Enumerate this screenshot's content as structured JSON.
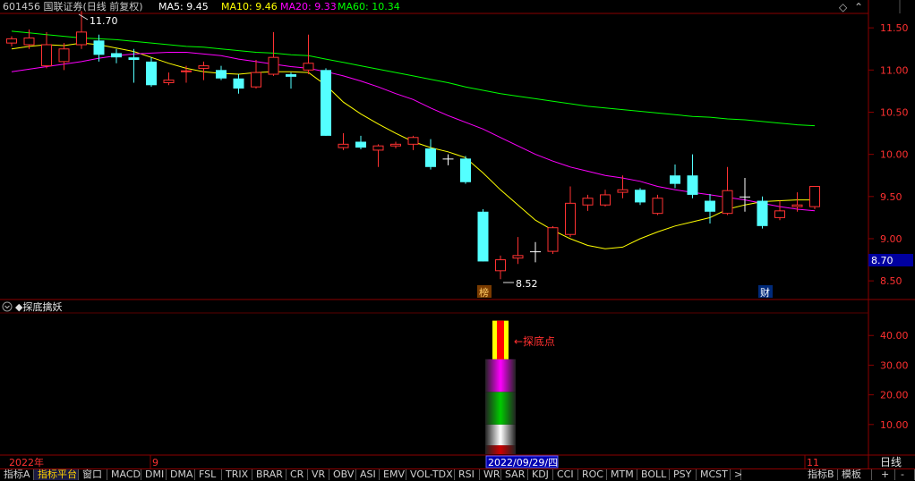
{
  "header": {
    "stock_label": "601456 国联证券(日线 前复权)",
    "ma5_label": "MA5: 9.45",
    "ma10_label": "MA10: 9.46",
    "ma20_label": "MA20: 9.33",
    "ma60_label": "MA60: 10.34",
    "colors": {
      "ma5": "#ffffff",
      "ma10": "#ffff00",
      "ma20": "#ff00ff",
      "ma60": "#00ff00"
    }
  },
  "indicator": {
    "title": "◆探底擒妖",
    "marker_label": "←探底点",
    "y_ticks": [
      "40.00",
      "30.00",
      "20.00",
      "10.00"
    ]
  },
  "price_axis": {
    "ticks": [
      "11.50",
      "11.00",
      "10.50",
      "10.00",
      "9.50",
      "9.00",
      "8.50"
    ],
    "current_price_badge": "8.70"
  },
  "annotations": {
    "high_label": "11.70",
    "low_label": "8.52",
    "badge_bang": "榜",
    "badge_cai": "财"
  },
  "time_axis": {
    "year_label": "2022年",
    "month_9_label": "9",
    "date_cursor_label": "2022/09/29/四",
    "month_11_label": "11",
    "period_label": "日线"
  },
  "tabs": [
    "指标A",
    "指标平台",
    "窗口",
    "MACD",
    "DMI",
    "DMA",
    "FSL",
    "TRIX",
    "BRAR",
    "CR",
    "VR",
    "OBV",
    "ASI",
    "EMV",
    "VOL-TDX",
    "RSI",
    "WR",
    "SAR",
    "KDJ",
    "CCI",
    "ROC",
    "MTM",
    "BOLL",
    "PSY",
    "MCST",
    ">"
  ],
  "right_tabs": [
    "指标B",
    "模板",
    "+",
    "-"
  ],
  "chart_data": [
    {
      "type": "candlestick",
      "title": "601456 国联证券(日线 前复权)",
      "ylim": [
        8.3,
        11.65
      ],
      "y_ticks": [
        11.5,
        11.0,
        10.5,
        10.0,
        9.5,
        9.0,
        8.5
      ],
      "candles": [
        {
          "o": 11.32,
          "h": 11.4,
          "l": 11.28,
          "c": 11.37
        },
        {
          "o": 11.3,
          "h": 11.48,
          "l": 11.25,
          "c": 11.38
        },
        {
          "o": 11.05,
          "h": 11.45,
          "l": 11.02,
          "c": 11.3
        },
        {
          "o": 11.1,
          "h": 11.32,
          "l": 11.0,
          "c": 11.25
        },
        {
          "o": 11.3,
          "h": 11.7,
          "l": 11.25,
          "c": 11.45
        },
        {
          "o": 11.35,
          "h": 11.42,
          "l": 11.1,
          "c": 11.18
        },
        {
          "o": 11.2,
          "h": 11.25,
          "l": 11.08,
          "c": 11.15
        },
        {
          "o": 11.15,
          "h": 11.25,
          "l": 10.85,
          "c": 11.12
        },
        {
          "o": 11.1,
          "h": 11.15,
          "l": 10.8,
          "c": 10.82
        },
        {
          "o": 10.85,
          "h": 10.97,
          "l": 10.82,
          "c": 10.88
        },
        {
          "o": 10.98,
          "h": 11.05,
          "l": 10.85,
          "c": 10.99
        },
        {
          "o": 11.02,
          "h": 11.1,
          "l": 10.88,
          "c": 11.05
        },
        {
          "o": 11.0,
          "h": 11.05,
          "l": 10.88,
          "c": 10.9
        },
        {
          "o": 10.9,
          "h": 10.95,
          "l": 10.72,
          "c": 10.78
        },
        {
          "o": 10.8,
          "h": 11.12,
          "l": 10.78,
          "c": 10.97
        },
        {
          "o": 10.95,
          "h": 11.45,
          "l": 10.93,
          "c": 11.15
        },
        {
          "o": 10.95,
          "h": 10.97,
          "l": 10.78,
          "c": 10.92
        },
        {
          "o": 11.0,
          "h": 11.42,
          "l": 10.95,
          "c": 11.08
        },
        {
          "o": 11.0,
          "h": 11.02,
          "l": 10.22,
          "c": 10.22
        },
        {
          "o": 10.08,
          "h": 10.25,
          "l": 10.05,
          "c": 10.12
        },
        {
          "o": 10.15,
          "h": 10.22,
          "l": 10.06,
          "c": 10.08
        },
        {
          "o": 10.05,
          "h": 10.12,
          "l": 9.85,
          "c": 10.1
        },
        {
          "o": 10.1,
          "h": 10.15,
          "l": 10.07,
          "c": 10.12
        },
        {
          "o": 10.12,
          "h": 10.22,
          "l": 10.05,
          "c": 10.2
        },
        {
          "o": 10.07,
          "h": 10.18,
          "l": 9.82,
          "c": 9.85
        },
        {
          "o": 9.95,
          "h": 10.0,
          "l": 9.87,
          "c": 9.95
        },
        {
          "o": 9.95,
          "h": 9.98,
          "l": 9.65,
          "c": 9.67
        },
        {
          "o": 9.32,
          "h": 9.35,
          "l": 8.73,
          "c": 8.73
        },
        {
          "o": 8.62,
          "h": 8.8,
          "l": 8.52,
          "c": 8.75
        },
        {
          "o": 8.77,
          "h": 9.02,
          "l": 8.7,
          "c": 8.8
        },
        {
          "o": 8.85,
          "h": 8.96,
          "l": 8.72,
          "c": 8.85
        },
        {
          "o": 8.85,
          "h": 9.15,
          "l": 8.82,
          "c": 9.13
        },
        {
          "o": 9.05,
          "h": 9.62,
          "l": 9.02,
          "c": 9.42
        },
        {
          "o": 9.4,
          "h": 9.52,
          "l": 9.33,
          "c": 9.48
        },
        {
          "o": 9.4,
          "h": 9.58,
          "l": 9.38,
          "c": 9.52
        },
        {
          "o": 9.55,
          "h": 9.75,
          "l": 9.48,
          "c": 9.58
        },
        {
          "o": 9.58,
          "h": 9.6,
          "l": 9.4,
          "c": 9.43
        },
        {
          "o": 9.3,
          "h": 9.52,
          "l": 9.28,
          "c": 9.48
        },
        {
          "o": 9.75,
          "h": 9.88,
          "l": 9.6,
          "c": 9.65
        },
        {
          "o": 9.75,
          "h": 10.0,
          "l": 9.48,
          "c": 9.52
        },
        {
          "o": 9.45,
          "h": 9.53,
          "l": 9.18,
          "c": 9.32
        },
        {
          "o": 9.3,
          "h": 9.85,
          "l": 9.28,
          "c": 9.57
        },
        {
          "o": 9.5,
          "h": 9.72,
          "l": 9.32,
          "c": 9.5
        },
        {
          "o": 9.45,
          "h": 9.5,
          "l": 9.12,
          "c": 9.15
        },
        {
          "o": 9.25,
          "h": 9.45,
          "l": 9.22,
          "c": 9.33
        },
        {
          "o": 9.38,
          "h": 9.55,
          "l": 9.32,
          "c": 9.4
        },
        {
          "o": 9.38,
          "h": 9.6,
          "l": 9.35,
          "c": 9.62
        }
      ],
      "series": [
        {
          "name": "MA10",
          "color": "#ffff00",
          "values": [
            11.25,
            11.28,
            11.3,
            11.29,
            11.32,
            11.3,
            11.26,
            11.22,
            11.15,
            11.08,
            11.02,
            10.98,
            10.96,
            10.95,
            10.97,
            10.98,
            10.98,
            10.97,
            10.82,
            10.62,
            10.48,
            10.36,
            10.25,
            10.15,
            10.08,
            10.03,
            9.96,
            9.78,
            9.58,
            9.4,
            9.22,
            9.1,
            9.0,
            8.92,
            8.88,
            8.9,
            9.0,
            9.08,
            9.15,
            9.2,
            9.25,
            9.35,
            9.4,
            9.44,
            9.45,
            9.46,
            9.46
          ]
        },
        {
          "name": "MA20",
          "color": "#ff00ff",
          "values": [
            10.98,
            11.01,
            11.04,
            11.07,
            11.1,
            11.14,
            11.17,
            11.19,
            11.2,
            11.21,
            11.21,
            11.19,
            11.17,
            11.13,
            11.1,
            11.07,
            11.04,
            11.02,
            10.98,
            10.93,
            10.87,
            10.8,
            10.72,
            10.65,
            10.55,
            10.46,
            10.38,
            10.3,
            10.2,
            10.1,
            10.0,
            9.92,
            9.85,
            9.8,
            9.75,
            9.72,
            9.68,
            9.62,
            9.58,
            9.55,
            9.52,
            9.49,
            9.46,
            9.42,
            9.38,
            9.35,
            9.33
          ]
        },
        {
          "name": "MA60",
          "color": "#00ff00",
          "values": [
            11.46,
            11.44,
            11.42,
            11.4,
            11.38,
            11.37,
            11.36,
            11.34,
            11.32,
            11.3,
            11.28,
            11.27,
            11.25,
            11.23,
            11.21,
            11.2,
            11.18,
            11.17,
            11.13,
            11.09,
            11.05,
            11.01,
            10.97,
            10.93,
            10.89,
            10.85,
            10.8,
            10.76,
            10.72,
            10.69,
            10.66,
            10.63,
            10.6,
            10.57,
            10.55,
            10.53,
            10.51,
            10.49,
            10.47,
            10.45,
            10.44,
            10.42,
            10.41,
            10.39,
            10.37,
            10.35,
            10.34
          ]
        }
      ]
    },
    {
      "type": "bar",
      "title": "◆探底擒妖",
      "ylim": [
        0,
        47
      ],
      "y_ticks": [
        40,
        30,
        20,
        10
      ],
      "bar_index": 28,
      "segments": [
        {
          "from": 0,
          "to": 3,
          "color": "#cc0000"
        },
        {
          "from": 3,
          "to": 10,
          "color": "#ffffff"
        },
        {
          "from": 10,
          "to": 21,
          "color": "#00cc00"
        },
        {
          "from": 21,
          "to": 32,
          "color": "#ff00ff"
        },
        {
          "from": 32,
          "to": 45,
          "color": "#ffff00",
          "stripe": "#ff0000"
        }
      ]
    }
  ]
}
